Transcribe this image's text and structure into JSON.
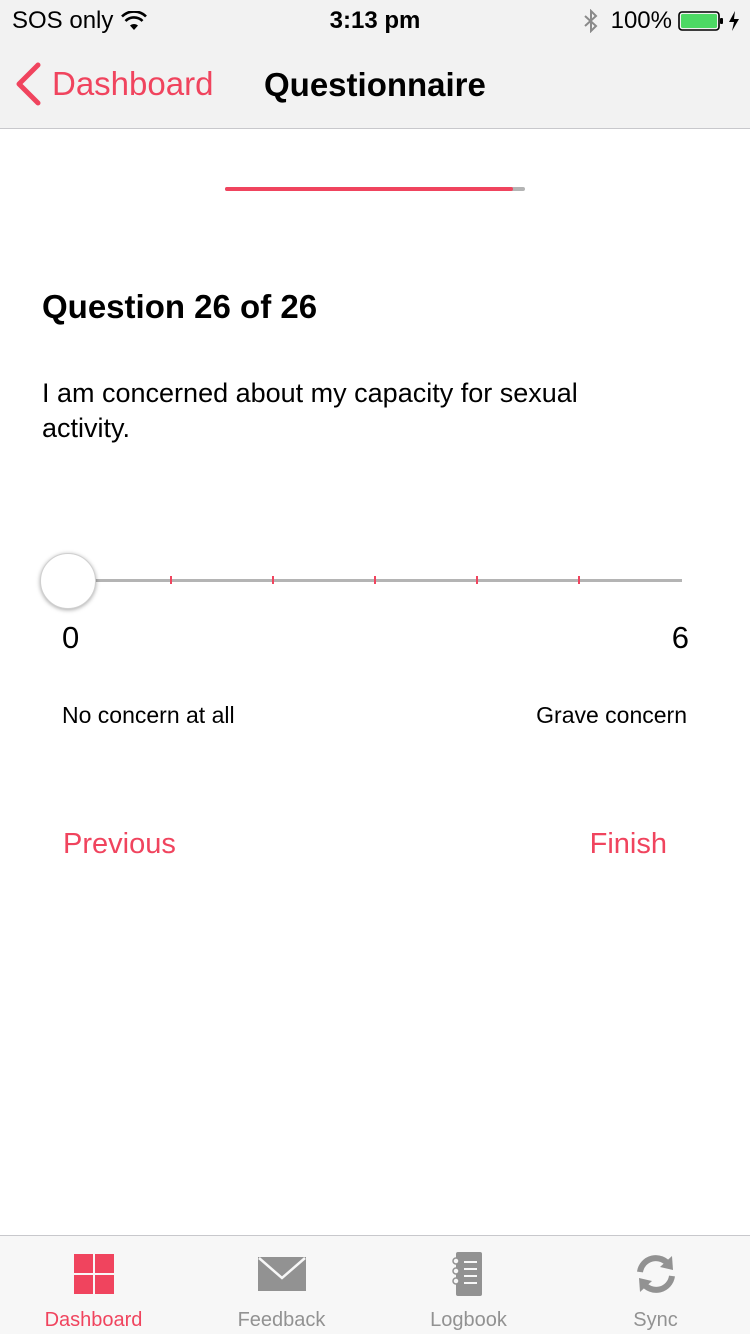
{
  "status_bar": {
    "carrier": "SOS only",
    "time": "3:13 pm",
    "battery": "100%",
    "icons": [
      "wifi-icon",
      "bluetooth-icon",
      "battery-icon",
      "charging-icon"
    ]
  },
  "nav": {
    "back_label": "Dashboard",
    "title": "Questionnaire"
  },
  "progress": {
    "fraction": 0.96
  },
  "question": {
    "heading": "Question 26 of 26",
    "text": "I am concerned about my capacity for sexual activity."
  },
  "slider": {
    "min": 0,
    "max": 6,
    "value": 0,
    "min_label": "0",
    "max_label": "6",
    "min_anchor": "No concern at all",
    "max_anchor": "Grave concern"
  },
  "actions": {
    "previous": "Previous",
    "finish": "Finish"
  },
  "tabs": [
    {
      "label": "Dashboard",
      "icon": "dashboard-grid-icon",
      "active": true
    },
    {
      "label": "Feedback",
      "icon": "envelope-icon",
      "active": false
    },
    {
      "label": "Logbook",
      "icon": "notebook-icon",
      "active": false
    },
    {
      "label": "Sync",
      "icon": "sync-icon",
      "active": false
    }
  ],
  "colors": {
    "accent": "#f0445e",
    "inactive": "#929292",
    "track": "#b4b4b4"
  }
}
